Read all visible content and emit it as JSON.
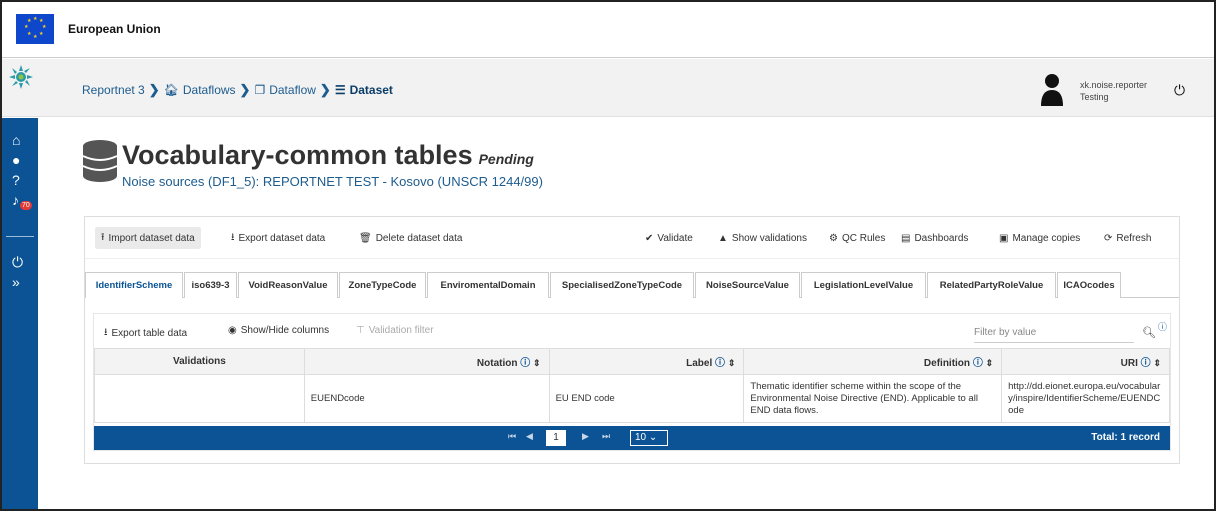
{
  "eu_bar": {
    "title": "European Union"
  },
  "breadcrumb": [
    {
      "label": "Reportnet 3",
      "icon": ""
    },
    {
      "label": "Dataflows",
      "icon": "home-icon"
    },
    {
      "label": "Dataflow",
      "icon": "clone-icon"
    },
    {
      "label": "Dataset",
      "icon": "database-icon"
    }
  ],
  "user": {
    "name": "xk.noise.reporter",
    "role": "Testing"
  },
  "sidebar": {
    "notification_count": "70"
  },
  "dataset": {
    "title": "Vocabulary-common tables",
    "status": "Pending",
    "subtitle": "Noise sources (DF1_5): REPORTNET TEST - Kosovo (UNSCR 1244/99)"
  },
  "toolbar": {
    "import": "Import dataset data",
    "export": "Export dataset data",
    "delete": "Delete dataset data",
    "validate": "Validate",
    "show_validations": "Show validations",
    "qc_rules": "QC Rules",
    "dashboards": "Dashboards",
    "manage_copies": "Manage copies",
    "refresh": "Refresh"
  },
  "tabs": [
    "IdentifierScheme",
    "iso639-3",
    "VoidReasonValue",
    "ZoneTypeCode",
    "EnviromentalDomain",
    "SpecialisedZoneTypeCode",
    "NoiseSourceValue",
    "LegislationLevelValue",
    "RelatedPartyRoleValue",
    "ICAOcodes"
  ],
  "table_tools": {
    "export": "Export table data",
    "show_hide": "Show/Hide columns",
    "validation_filter": "Validation filter",
    "filter_placeholder": "Filter by value"
  },
  "table": {
    "headers": [
      "Validations",
      "Notation",
      "Label",
      "Definition",
      "URI"
    ],
    "rows": [
      {
        "validations": "",
        "notation": "EUENDcode",
        "label": "EU END code",
        "definition": "Thematic identifier scheme within the scope of the Environmental Noise Directive (END). Applicable to all END data flows.",
        "uri": "http://dd.eionet.europa.eu/vocabulary/inspire/IdentifierScheme/EUENDCode"
      }
    ]
  },
  "paginator": {
    "page": "1",
    "rows": "10",
    "total": "Total: 1 record"
  },
  "colors": {
    "primary": "#0b5394",
    "link": "#1d5c8e"
  }
}
